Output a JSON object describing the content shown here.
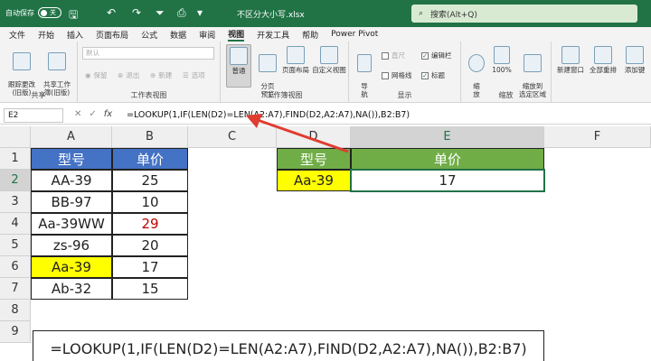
{
  "titlebar": {
    "autosave_label": "自动保存",
    "autosave_state": "关",
    "filename": "不区分大小写.xlsx",
    "search_placeholder": "搜索(Alt+Q)"
  },
  "menu": [
    "文件",
    "开始",
    "插入",
    "页面布局",
    "公式",
    "数据",
    "审阅",
    "视图",
    "开发工具",
    "帮助",
    "Power Pivot"
  ],
  "menu_active": "视图",
  "ribbon": {
    "share_group": {
      "label": "共享",
      "track_changes": "跟踪更改\n(旧版)",
      "share_workbook": "共享工作\n簿(旧版)"
    },
    "sheet_view_group": {
      "label": "工作表视图",
      "default_dropdown": "默认",
      "keep": "保留",
      "exit": "退出",
      "new": "新建",
      "options": "选项"
    },
    "workbook_views_group": {
      "label": "工作簿视图",
      "normal": "普通",
      "page_break": "分页\n预览",
      "page_layout": "页面布局",
      "custom_view": "自定义视图"
    },
    "show_group": {
      "label": "显示",
      "navigation": "导\n航",
      "ruler": "直尺",
      "formula_bar": "编辑栏",
      "gridlines": "网格线",
      "headings": "标题"
    },
    "zoom_group": {
      "label": "缩放",
      "zoom": "缩\n放",
      "zoom100": "100%",
      "zoom_selection": "缩放到\n选定区域"
    },
    "window_group": {
      "new_window": "新建窗口",
      "arrange_all": "全部重排",
      "add_watch": "添加键"
    }
  },
  "formula_bar": {
    "namebox": "E2",
    "formula": "=LOOKUP(1,IF(LEN(D2)=LEN(A2:A7),FIND(D2,A2:A7),NA()),B2:B7)"
  },
  "columns": [
    "A",
    "B",
    "C",
    "D",
    "E",
    "F"
  ],
  "rows": [
    "1",
    "2",
    "3",
    "4",
    "5",
    "6",
    "7",
    "8",
    "9"
  ],
  "table1": {
    "headers": [
      "型号",
      "单价"
    ],
    "rows": [
      [
        "AA-39",
        "25"
      ],
      [
        "BB-97",
        "10"
      ],
      [
        "Aa-39WW",
        "29"
      ],
      [
        "zs-96",
        "20"
      ],
      [
        "Aa-39",
        "17"
      ],
      [
        "Ab-32",
        "15"
      ]
    ]
  },
  "table2": {
    "headers": [
      "型号",
      "单价"
    ],
    "lookup": "Aa-39",
    "result": "17"
  },
  "formula_box": "=LOOKUP(1,IF(LEN(D2)=LEN(A2:A7),FIND(D2,A2:A7),NA()),B2:B7)",
  "colors": {
    "excel_green": "#217346",
    "header_blue": "#4472c4",
    "header_green": "#70ad47",
    "highlight_yellow": "#ffff00",
    "red_value": "#c00000",
    "arrow_red": "#e03c31"
  }
}
